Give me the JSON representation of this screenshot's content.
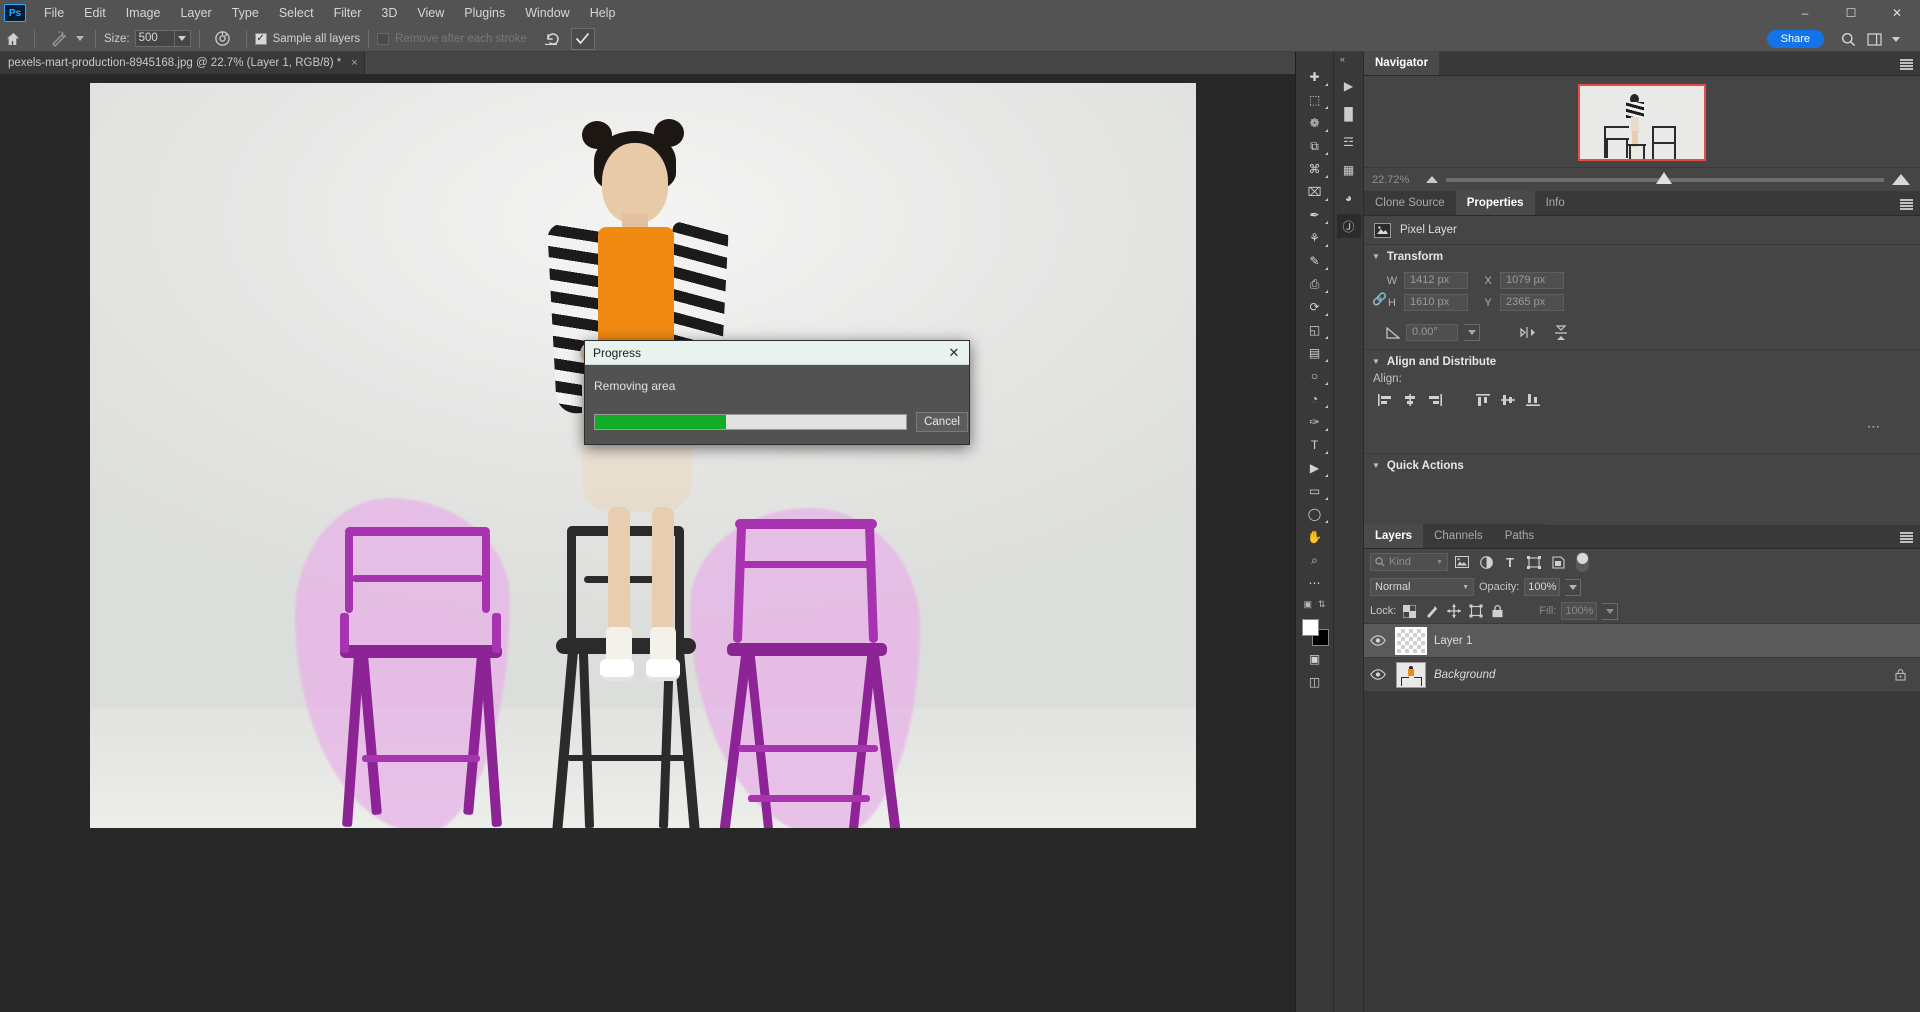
{
  "app": {
    "name": "Adobe Photoshop",
    "logo_text": "Ps"
  },
  "menubar": {
    "items": [
      {
        "label": "File"
      },
      {
        "label": "Edit"
      },
      {
        "label": "Image"
      },
      {
        "label": "Layer"
      },
      {
        "label": "Type"
      },
      {
        "label": "Select"
      },
      {
        "label": "Filter"
      },
      {
        "label": "3D"
      },
      {
        "label": "View"
      },
      {
        "label": "Plugins"
      },
      {
        "label": "Window"
      },
      {
        "label": "Help"
      }
    ],
    "window_controls": {
      "minimize": "–",
      "maximize": "☐",
      "close": "✕"
    }
  },
  "optionsbar": {
    "home_icon": "home-icon",
    "tool_icon": "spot-healing-brush-icon",
    "size_label": "Size:",
    "size_value": "500",
    "brush_settings_icon": "brush-settings-icon",
    "sample_all_layers": {
      "label": "Sample all layers",
      "checked": true
    },
    "remove_after_stroke": {
      "label": "Remove after each stroke",
      "checked": false,
      "disabled": true
    },
    "reset_icon": "undo-reset-icon",
    "commit_icon": "checkmark-commit-icon",
    "share_label": "Share",
    "search_icon": "search-icon",
    "workspace_icon": "workspace-switcher-icon"
  },
  "document": {
    "tab_title": "pexels-mart-production-8945168.jpg @ 22.7% (Layer 1, RGB/8) *",
    "close_icon": "×"
  },
  "dialog": {
    "title": "Progress",
    "message": "Removing area",
    "progress_percent": 42,
    "cancel_label": "Cancel",
    "close_icon": "✕",
    "progress_color": "#12ac29"
  },
  "toolstrip": {
    "tools": [
      {
        "name": "move-tool",
        "glyph": "✚"
      },
      {
        "name": "rectangular-marquee-tool",
        "glyph": "⬚"
      },
      {
        "name": "lasso-tool",
        "glyph": "❁"
      },
      {
        "name": "object-selection-tool",
        "glyph": "⧉"
      },
      {
        "name": "crop-tool",
        "glyph": "⌘"
      },
      {
        "name": "frame-tool",
        "glyph": "⌧"
      },
      {
        "name": "eyedropper-tool",
        "glyph": "✒"
      },
      {
        "name": "spot-healing-brush-tool",
        "glyph": "⚘"
      },
      {
        "name": "brush-tool",
        "glyph": "✎"
      },
      {
        "name": "clone-stamp-tool",
        "glyph": "⎙"
      },
      {
        "name": "history-brush-tool",
        "glyph": "⟳"
      },
      {
        "name": "eraser-tool",
        "glyph": "◱"
      },
      {
        "name": "gradient-tool",
        "glyph": "▤"
      },
      {
        "name": "blur-tool",
        "glyph": "○"
      },
      {
        "name": "dodge-tool",
        "glyph": "◔"
      },
      {
        "name": "pen-tool",
        "glyph": "✑"
      },
      {
        "name": "type-tool",
        "glyph": "T"
      },
      {
        "name": "path-selection-tool",
        "glyph": "▶"
      },
      {
        "name": "rectangle-tool",
        "glyph": "▭"
      },
      {
        "name": "ellipse-tool",
        "glyph": "◯"
      },
      {
        "name": "hand-tool",
        "glyph": "✋"
      },
      {
        "name": "zoom-tool",
        "glyph": "⌕"
      },
      {
        "name": "edit-toolbar-more",
        "glyph": "⋯"
      }
    ],
    "foreground_color": "#ffffff",
    "background_color": "#000000",
    "quick-mask-icon": "quick-mask-icon",
    "screen-mode-icon": "screen-mode-icon"
  },
  "dock_narrow": {
    "icons": [
      {
        "name": "play-timeline-icon",
        "glyph": "▶"
      },
      {
        "name": "histogram-icon",
        "glyph": "█"
      },
      {
        "name": "adjustments-icon",
        "glyph": "☲"
      },
      {
        "name": "libraries-icon",
        "glyph": "▦"
      },
      {
        "name": "color-wheel-icon",
        "glyph": "◕"
      },
      {
        "name": "properties-dock-icon",
        "glyph": "Ⓙ"
      }
    ]
  },
  "navigator": {
    "tab_label": "Navigator",
    "zoom_value": "22.72%",
    "view_border_color": "#e94b4b",
    "zoom_out_icon": "zoom-out-icon",
    "zoom_in_icon": "zoom-in-icon"
  },
  "properties": {
    "tabs": [
      {
        "label": "Clone Source",
        "active": false
      },
      {
        "label": "Properties",
        "active": true
      },
      {
        "label": "Info",
        "active": false
      }
    ],
    "layer_type": "Pixel Layer",
    "transform": {
      "section_title": "Transform",
      "w_label": "W",
      "w_value": "1412 px",
      "h_label": "H",
      "h_value": "1610 px",
      "x_label": "X",
      "x_value": "1079 px",
      "y_label": "Y",
      "y_value": "2365 px",
      "angle_label": "angle-icon",
      "angle_value": "0.00°",
      "flip_h_icon": "flip-horizontal-icon",
      "flip_v_icon": "flip-vertical-icon",
      "link_icon": "link-wh-icon"
    },
    "align": {
      "section_title": "Align and Distribute",
      "label": "Align:",
      "buttons": [
        {
          "name": "align-left-icon"
        },
        {
          "name": "align-center-horizontal-icon"
        },
        {
          "name": "align-right-icon"
        },
        {
          "name": "align-top-icon"
        },
        {
          "name": "align-middle-vertical-icon"
        },
        {
          "name": "align-bottom-icon"
        }
      ],
      "more_glyph": "⋯"
    },
    "quick_actions": {
      "section_title": "Quick Actions"
    }
  },
  "layers": {
    "tabs": [
      {
        "label": "Layers",
        "active": true
      },
      {
        "label": "Channels",
        "active": false
      },
      {
        "label": "Paths",
        "active": false
      }
    ],
    "filter": {
      "search_icon": "search-icon",
      "kind_label": "Kind",
      "filter_icons": [
        {
          "name": "filter-pixel-icon",
          "glyph": "⛰"
        },
        {
          "name": "filter-adjustment-icon",
          "glyph": "◑"
        },
        {
          "name": "filter-type-icon",
          "glyph": "T"
        },
        {
          "name": "filter-shape-icon",
          "glyph": "⬚"
        },
        {
          "name": "filter-smart-object-icon",
          "glyph": "❐"
        }
      ],
      "toggle_name": "filter-enable-toggle"
    },
    "blend_mode": "Normal",
    "opacity_label": "Opacity:",
    "opacity_value": "100%",
    "lock_label": "Lock:",
    "lock_icons": [
      {
        "name": "lock-transparent-pixels-icon",
        "glyph": "▒"
      },
      {
        "name": "lock-image-pixels-icon",
        "glyph": "✎"
      },
      {
        "name": "lock-position-icon",
        "glyph": "✥"
      },
      {
        "name": "lock-artboard-nesting-icon",
        "glyph": "⌧"
      },
      {
        "name": "lock-all-icon",
        "glyph": "🔒"
      }
    ],
    "fill_label": "Fill:",
    "fill_value": "100%",
    "rows": [
      {
        "name": "Layer 1",
        "selected": true,
        "visible": true,
        "locked": false,
        "italic": false,
        "thumb": "transparent"
      },
      {
        "name": "Background",
        "selected": false,
        "visible": true,
        "locked": true,
        "italic": true,
        "thumb": "photo"
      }
    ],
    "lock_glyph": "🔒"
  },
  "canvas": {
    "image_description": "girl-standing-on-chair-photo",
    "selection_color": "#e8b3e8",
    "chair_color": "#a833b0",
    "center_chair_color": "#2b2b2b",
    "shirt_color": "#f08a11"
  }
}
